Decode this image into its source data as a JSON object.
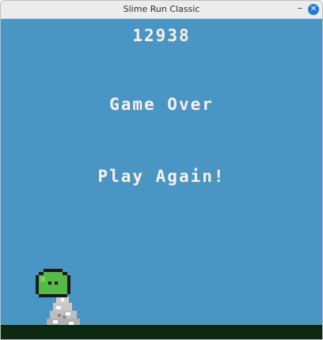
{
  "window": {
    "title": "Slime Run Classic",
    "minimize_glyph": "–",
    "close_glyph": "✕"
  },
  "game": {
    "score": "12938",
    "status": "Game Over",
    "play_again_label": "Play Again!",
    "colors": {
      "sky": "#4996c4",
      "ground": "#0d2a12",
      "slime": "#56b947",
      "text": "#f2f2f2"
    }
  }
}
